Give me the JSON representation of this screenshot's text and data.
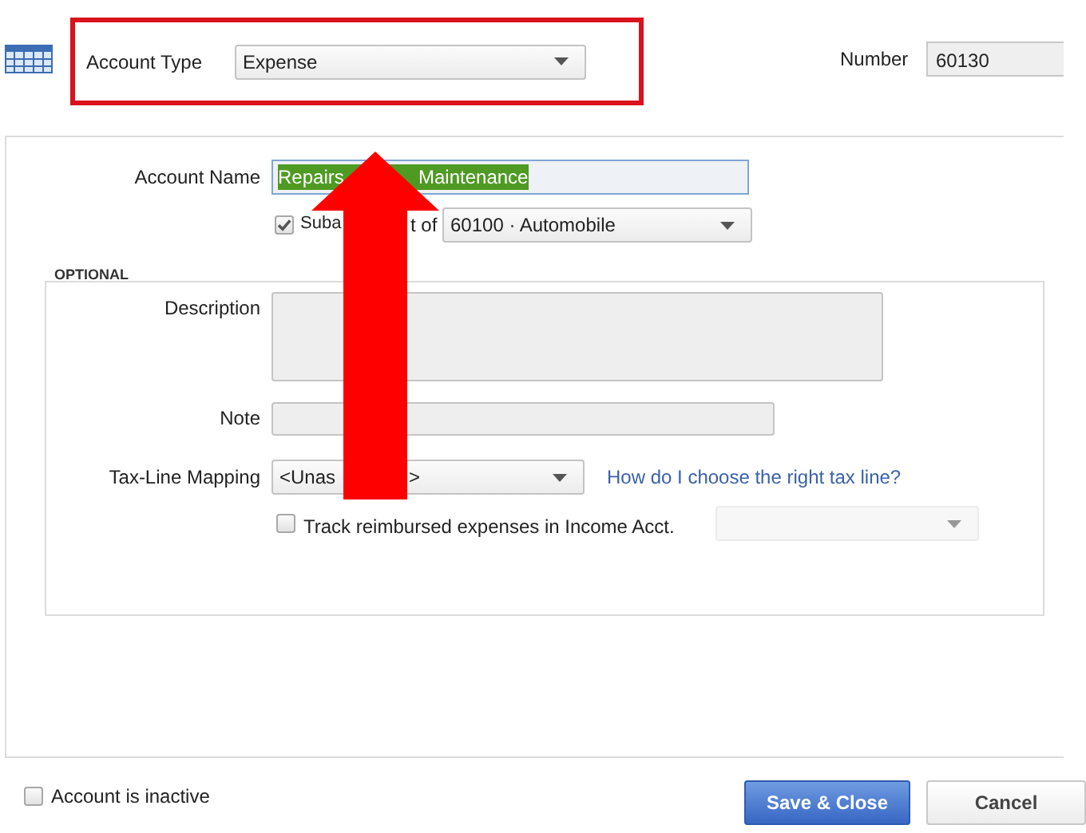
{
  "header": {
    "account_type": {
      "label": "Account Type",
      "value": "Expense"
    },
    "number": {
      "label": "Number",
      "value": "60130"
    }
  },
  "account_name": {
    "label": "Account Name",
    "value_parts": [
      "Repairs",
      "Maintenance"
    ],
    "text_selected": true
  },
  "subaccount": {
    "checked": true,
    "label_parts": [
      "Suba",
      "t of"
    ],
    "value": "60100 · Automobile"
  },
  "optional": {
    "title": "OPTIONAL",
    "description": {
      "label": "Description"
    },
    "note": {
      "label": "Note"
    },
    "tax_line": {
      "label": "Tax-Line Mapping",
      "value_parts": [
        "<Unas",
        ">"
      ],
      "help_link": "How do I choose the right tax line?"
    },
    "track_reimbursed": {
      "checked": false,
      "label": "Track reimbursed expenses in Income Acct.",
      "income_account_disabled": true
    }
  },
  "inactive": {
    "label": "Account is inactive",
    "checked": false
  },
  "buttons": [
    {
      "label": "Save & Close",
      "kind": "primary"
    },
    {
      "label": "Cancel",
      "kind": "secondary"
    }
  ]
}
